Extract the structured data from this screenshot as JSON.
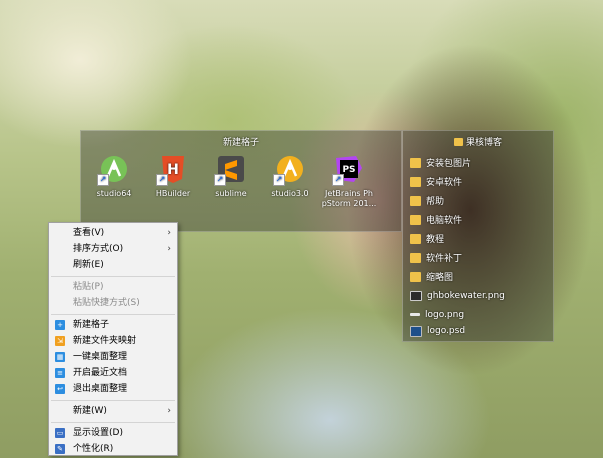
{
  "fence_left": {
    "title": "新建格子",
    "icons": [
      {
        "label": "studio64",
        "icon": "android-studio-icon",
        "color": "#78c257"
      },
      {
        "label": "HBuilder",
        "icon": "hbuilder-icon",
        "color": "#e44d26"
      },
      {
        "label": "sublime",
        "icon": "sublime-icon",
        "color": "#ff9800"
      },
      {
        "label": "studio3.0",
        "icon": "android-studio-icon",
        "color": "#f2b01e"
      },
      {
        "label": "JetBrains PhpStorm 201...",
        "line1": "JetBrains Ph",
        "line2": "pStorm 201...",
        "icon": "phpstorm-icon",
        "color": "#b345f1"
      }
    ]
  },
  "fence_right": {
    "title": "果核博客",
    "items": [
      {
        "label": "安装包图片",
        "icon": "folder-icon"
      },
      {
        "label": "安卓软件",
        "icon": "folder-icon"
      },
      {
        "label": "帮助",
        "icon": "folder-icon"
      },
      {
        "label": "电脑软件",
        "icon": "folder-icon"
      },
      {
        "label": "教程",
        "icon": "folder-icon"
      },
      {
        "label": "软件补丁",
        "icon": "folder-icon"
      },
      {
        "label": "缩略图",
        "icon": "folder-icon"
      },
      {
        "label": "ghbokewater.png",
        "icon": "image-file-icon"
      },
      {
        "label": "logo.png",
        "icon": "image-file-icon"
      },
      {
        "label": "logo.psd",
        "icon": "psd-file-icon"
      }
    ]
  },
  "context_menu": {
    "view": "查看(V)",
    "sort": "排序方式(O)",
    "refresh": "刷新(E)",
    "paste": "粘贴(P)",
    "paste_shortcut": "粘贴快捷方式(S)",
    "new_fence": "新建格子",
    "new_folder_map": "新建文件夹映射",
    "one_click_organize": "一键桌面整理",
    "open_recent": "开启最近文档",
    "exit_organize": "退出桌面整理",
    "new": "新建(W)",
    "display_settings": "显示设置(D)",
    "personalize": "个性化(R)",
    "submenu_arrow": "›"
  }
}
